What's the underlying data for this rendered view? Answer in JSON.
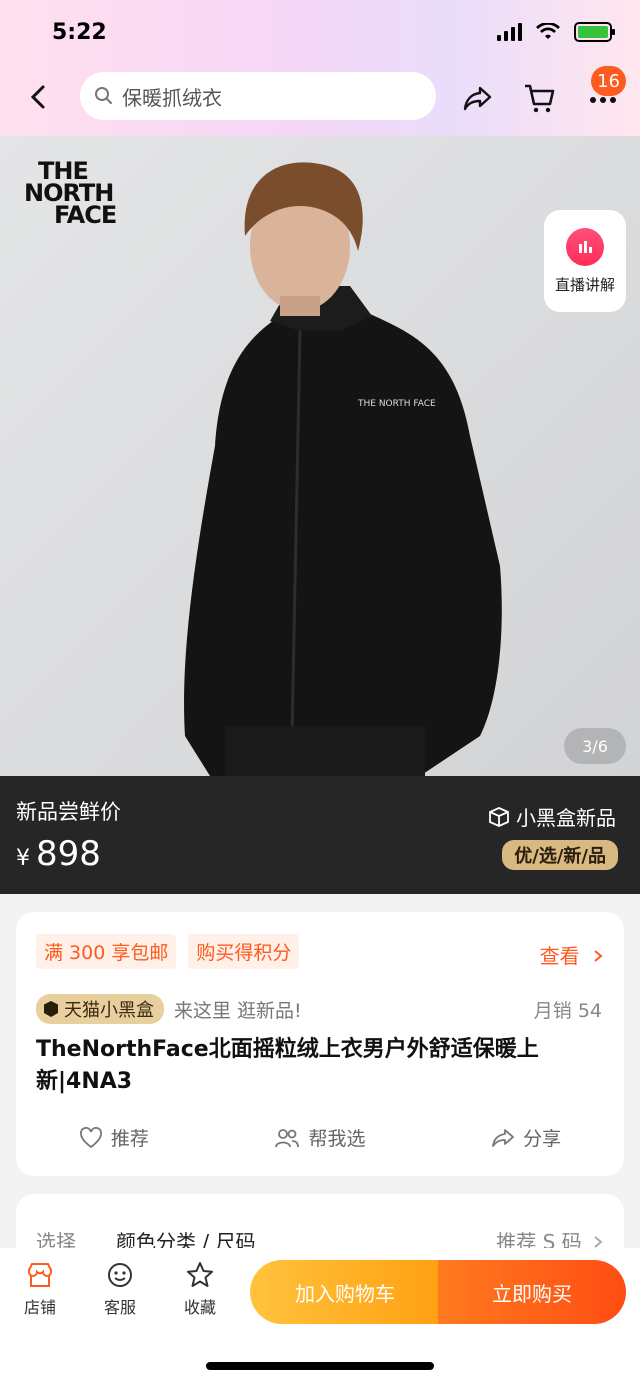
{
  "status_bar": {
    "time": "5:22"
  },
  "header": {
    "search_placeholder": "保暖抓绒衣",
    "more_badge": "16"
  },
  "hero": {
    "brand_lines": [
      "THE",
      "NORTH",
      "FACE"
    ],
    "live_label": "直播讲解",
    "image_counter": "3/6"
  },
  "price_band": {
    "label": "新品尝鲜价",
    "currency": "¥",
    "price": "898",
    "brand": "小黑盒新品",
    "tag": "优/选/新/品"
  },
  "info": {
    "chips": [
      "满 300 享包邮",
      "购买得积分"
    ],
    "see_label": "查看",
    "tmall_badge": "天猫小黑盒",
    "tmall_text": "来这里 逛新品!",
    "sales": "月销 54",
    "title": "TheNorthFace北面摇粒绒上衣男户外舒适保暖上新|4NA3",
    "actions": [
      "推荐",
      "帮我选",
      "分享"
    ]
  },
  "select": {
    "label": "选择",
    "value": "颜色分类 / 尺码",
    "right": "推荐 S 码"
  },
  "bottom_bar": {
    "tabs": [
      "店铺",
      "客服",
      "收藏"
    ],
    "add_to_cart": "加入购物车",
    "buy_now": "立即购买"
  },
  "colors": {
    "accent": "#ff5a1f",
    "cart": "#ffb229",
    "dark_band": "#262626"
  }
}
